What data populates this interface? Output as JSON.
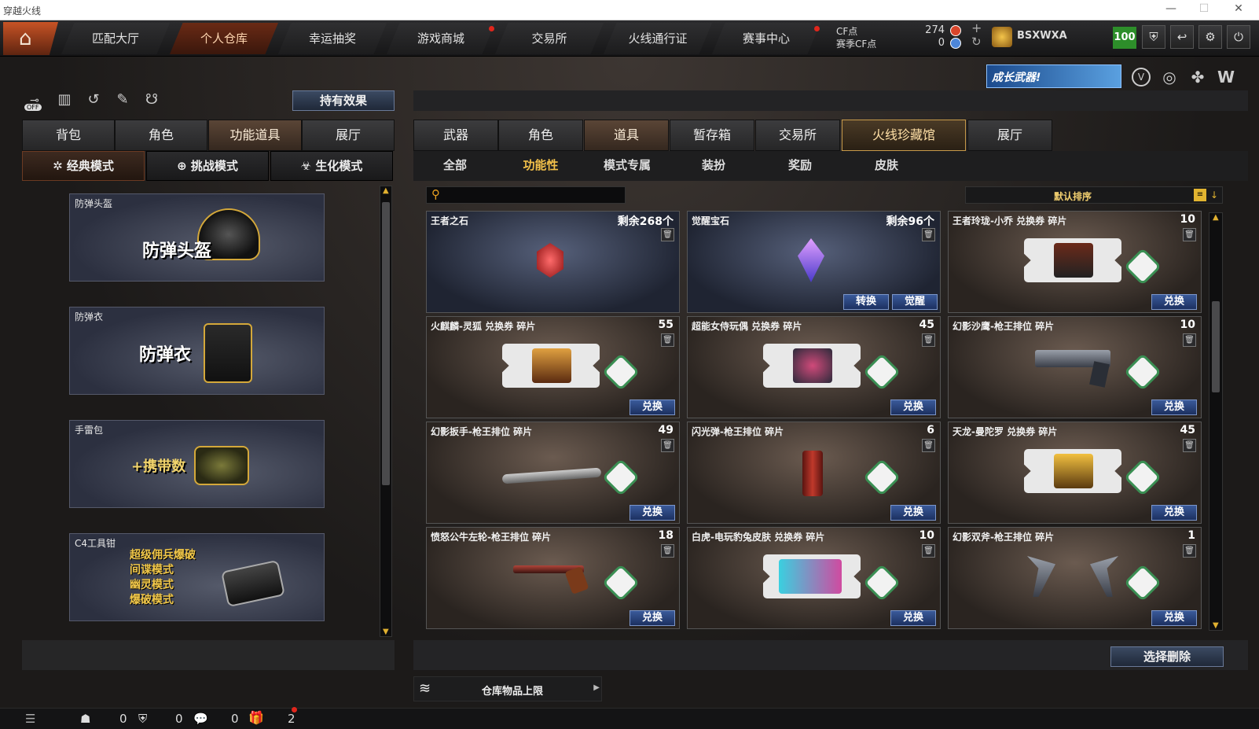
{
  "window": {
    "title": "穿越火线"
  },
  "nav": {
    "tabs": [
      "匹配大厅",
      "个人仓库",
      "幸运抽奖",
      "游戏商城",
      "交易所",
      "火线通行证",
      "赛事中心"
    ],
    "cf_label": "CF点",
    "cf_value": "274",
    "season_cf_label": "赛季CF点",
    "season_cf_value": "0",
    "plus": "+",
    "refresh": "↻",
    "username": "BSXWXA",
    "level": "100"
  },
  "banner": {
    "text": "成长武器!"
  },
  "left": {
    "off_label": "OFF",
    "effects_button": "持有效果",
    "tabs": [
      "背包",
      "角色",
      "功能道具",
      "展厅"
    ],
    "modes": [
      "经典模式",
      "挑战模式",
      "生化模式"
    ],
    "cards": [
      {
        "title": "防弹头盔",
        "big": "防弹头盔"
      },
      {
        "title": "防弹衣",
        "big": "防弹衣"
      },
      {
        "title": "手雷包",
        "big": "+携带数"
      },
      {
        "title": "C4工具钳",
        "lines": [
          "超级佣兵爆破",
          "间谍模式",
          "幽灵模式",
          "爆破模式"
        ]
      }
    ]
  },
  "right": {
    "tabs": [
      "武器",
      "角色",
      "道具",
      "暂存箱",
      "交易所",
      "火线珍藏馆",
      "展厅"
    ],
    "subtabs": [
      "全部",
      "功能性",
      "模式专属",
      "装扮",
      "奖励",
      "皮肤"
    ],
    "search_placeholder": "",
    "sort_label": "默认排序",
    "items": [
      {
        "title": "王者之石",
        "count": "剩余268个",
        "buttons": []
      },
      {
        "title": "觉醒宝石",
        "count": "剩余96个",
        "buttons": [
          "转换",
          "觉醒"
        ]
      },
      {
        "title": "王者玲珑-小乔 兑换券 碎片",
        "count": "10",
        "buttons": [
          "兑换"
        ]
      },
      {
        "title": "火麒麟-灵狐 兑换券 碎片",
        "count": "55",
        "buttons": [
          "兑换"
        ]
      },
      {
        "title": "超能女侍玩偶 兑换券 碎片",
        "count": "45",
        "buttons": [
          "兑换"
        ]
      },
      {
        "title": "幻影沙鹰-枪王排位 碎片",
        "count": "10",
        "buttons": [
          "兑换"
        ]
      },
      {
        "title": "幻影扳手-枪王排位 碎片",
        "count": "49",
        "buttons": [
          "兑换"
        ]
      },
      {
        "title": "闪光弹-枪王排位 碎片",
        "count": "6",
        "buttons": [
          "兑换"
        ]
      },
      {
        "title": "天龙-曼陀罗 兑换券 碎片",
        "count": "45",
        "buttons": [
          "兑换"
        ]
      },
      {
        "title": "愤怒公牛左轮-枪王排位 碎片",
        "count": "18",
        "buttons": [
          "兑换"
        ]
      },
      {
        "title": "白虎-电玩豹兔皮肤 兑换券 碎片",
        "count": "10",
        "buttons": [
          "兑换"
        ]
      },
      {
        "title": "幻影双斧-枪王排位 碎片",
        "count": "1",
        "buttons": [
          "兑换"
        ]
      }
    ],
    "select_delete": "选择删除",
    "capacity_label": "仓库物品上限"
  },
  "status": {
    "counts": [
      "0",
      "0",
      "0",
      "2"
    ]
  }
}
